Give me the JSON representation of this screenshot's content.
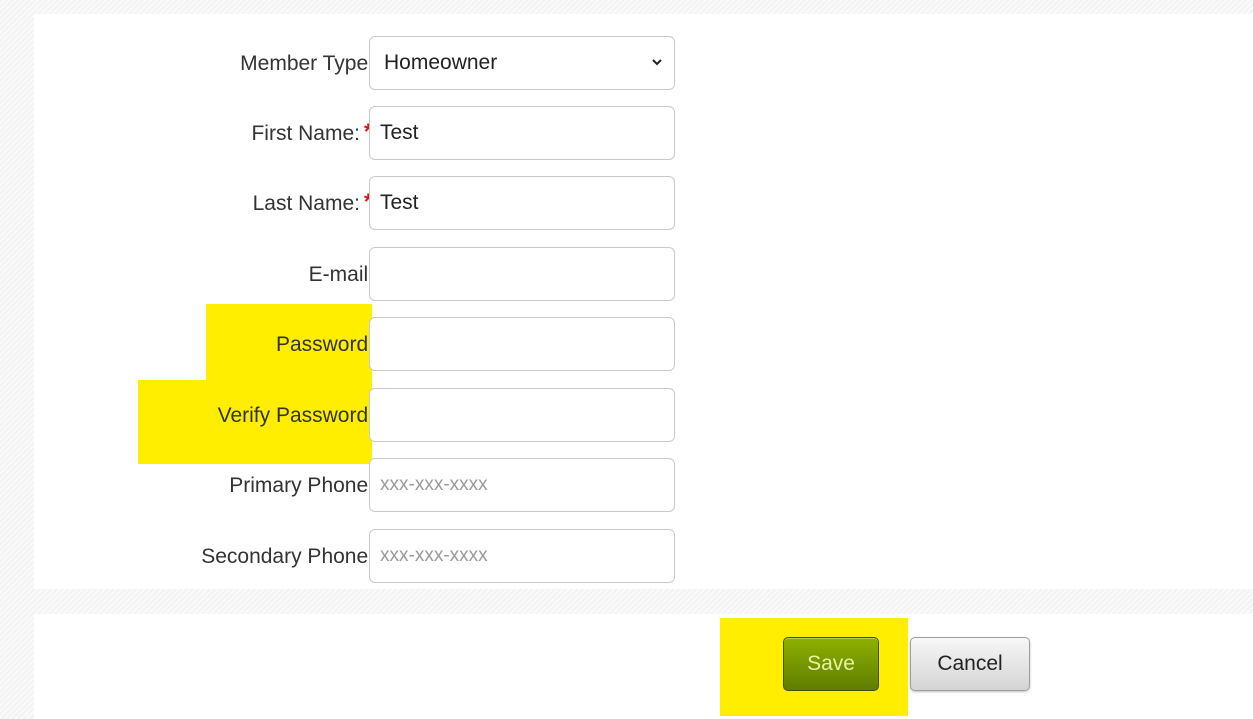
{
  "form": {
    "member_type": {
      "label": "Member Type:",
      "value": "Homeowner"
    },
    "first_name": {
      "label": "First Name:",
      "required_mark": "*",
      "value": "Test"
    },
    "last_name": {
      "label": "Last Name:",
      "required_mark": "*",
      "value": "Test"
    },
    "email": {
      "label": "E-mail:",
      "value": ""
    },
    "password": {
      "label": "Password:",
      "value": ""
    },
    "verify_password": {
      "label": "Verify Password:",
      "value": ""
    },
    "primary_phone": {
      "label": "Primary Phone:",
      "placeholder": "xxx-xxx-xxxx"
    },
    "secondary_phone": {
      "label": "Secondary Phone:",
      "placeholder": "xxx-xxx-xxxx"
    }
  },
  "actions": {
    "save_label": "Save",
    "cancel_label": "Cancel"
  },
  "colors": {
    "highlight": "#ffee00",
    "required": "#e01010",
    "save_button": "#6f8f00"
  },
  "icons": {
    "select_arrow": "chevron-down-icon"
  }
}
